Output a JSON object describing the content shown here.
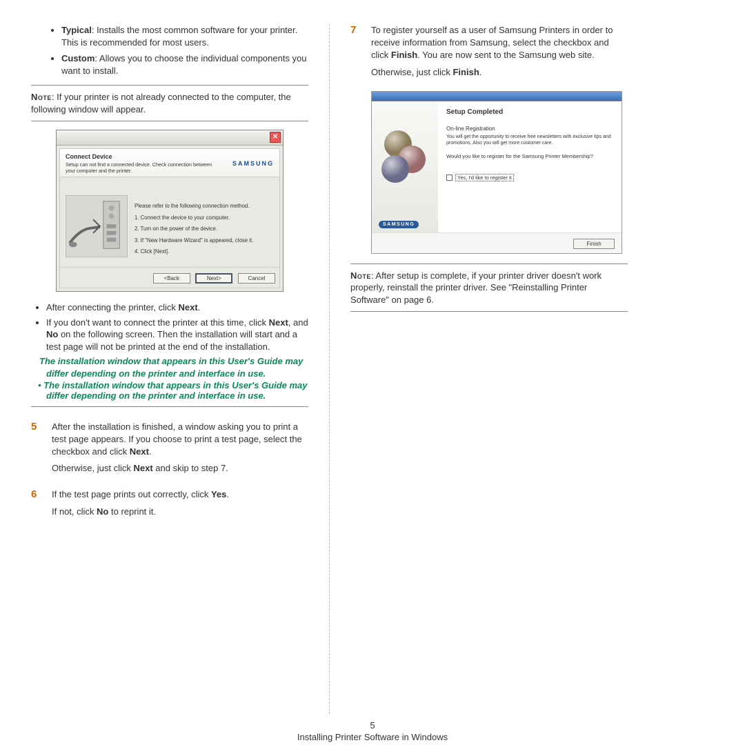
{
  "left": {
    "bullets_top": [
      {
        "label": "Typical",
        "text": ": Installs the most common software for your printer. This is recommended for most users."
      },
      {
        "label": "Custom",
        "text": ": Allows you to choose the individual components you want to install."
      }
    ],
    "note1_prefix": "Note",
    "note1_body": ": If your printer is not already connected to the computer, the following window will appear.",
    "dialog1": {
      "head_title": "Connect Device",
      "head_sub": "Setup can not find a connected device. Check connection between your computer and the printer.",
      "brand": "SAMSUNG",
      "steps_intro": "Please refer to the following connection method.",
      "steps": [
        "1. Connect the device to your computer.",
        "2. Turn on the power of the device.",
        "3. If \"New Hardware Wizard\" is appeared, close it.",
        "4. Click [Next]."
      ],
      "btn_back": "<Back",
      "btn_next": "Next>",
      "btn_cancel": "Cancel",
      "close_glyph": "✕"
    },
    "bullets_mid": [
      {
        "plain": "After connecting the printer, click ",
        "bold": "Next",
        "tail": "."
      },
      {
        "plain": "If you don't want to connect the printer at this time, click ",
        "bold": "Next",
        "mid": ", and ",
        "bold2": "No",
        "tail2": " on the following screen. Then the installation will start and a test page will not be printed at the end of the installation."
      }
    ],
    "green_note": "The installation window that appears in this User's Guide may differ depending on the printer and interface in use.",
    "step5_num": "5",
    "step5_a": "After the installation is finished, a window asking you to print a test page appears. If you choose to print a test page, select the checkbox and click ",
    "step5_a_bold": "Next",
    "step5_a_tail": ".",
    "step5_b": "Otherwise, just click ",
    "step5_b_bold": "Next",
    "step5_b_tail": " and skip to step 7.",
    "step6_num": "6",
    "step6_a": "If the test page prints out correctly, click ",
    "step6_a_bold": "Yes",
    "step6_a_tail": ".",
    "step6_b": "If not, click ",
    "step6_b_bold": "No",
    "step6_b_tail": " to reprint it."
  },
  "right": {
    "step7_num": "7",
    "step7_a": "To register yourself as a user of Samsung Printers in order to receive information from Samsung, select the checkbox and click ",
    "step7_a_bold": "Finish",
    "step7_a_tail": ". You are now sent to the Samsung web site.",
    "step7_b": "Otherwise, just click ",
    "step7_b_bold": "Finish",
    "step7_b_tail": ".",
    "dialog2": {
      "heading": "Setup Completed",
      "sub": "On-line Registration",
      "small": "You will get the opportunity to receive free newsletters with exclusive tips and promotions. Also you will get more customer care.",
      "question": "Would you like to register for the Samsung Printer Membership?",
      "check_label": "Yes, I'd like to register it",
      "brand": "SAMSUNG",
      "btn_finish": "Finish"
    },
    "note2_prefix": "Note",
    "note2_body": ": After setup is complete, if your printer driver doesn't work properly, reinstall the printer driver. See \"Reinstalling Printer Software\" on page 6."
  },
  "footer": {
    "page": "5",
    "chapter": "Installing Printer Software in Windows"
  }
}
